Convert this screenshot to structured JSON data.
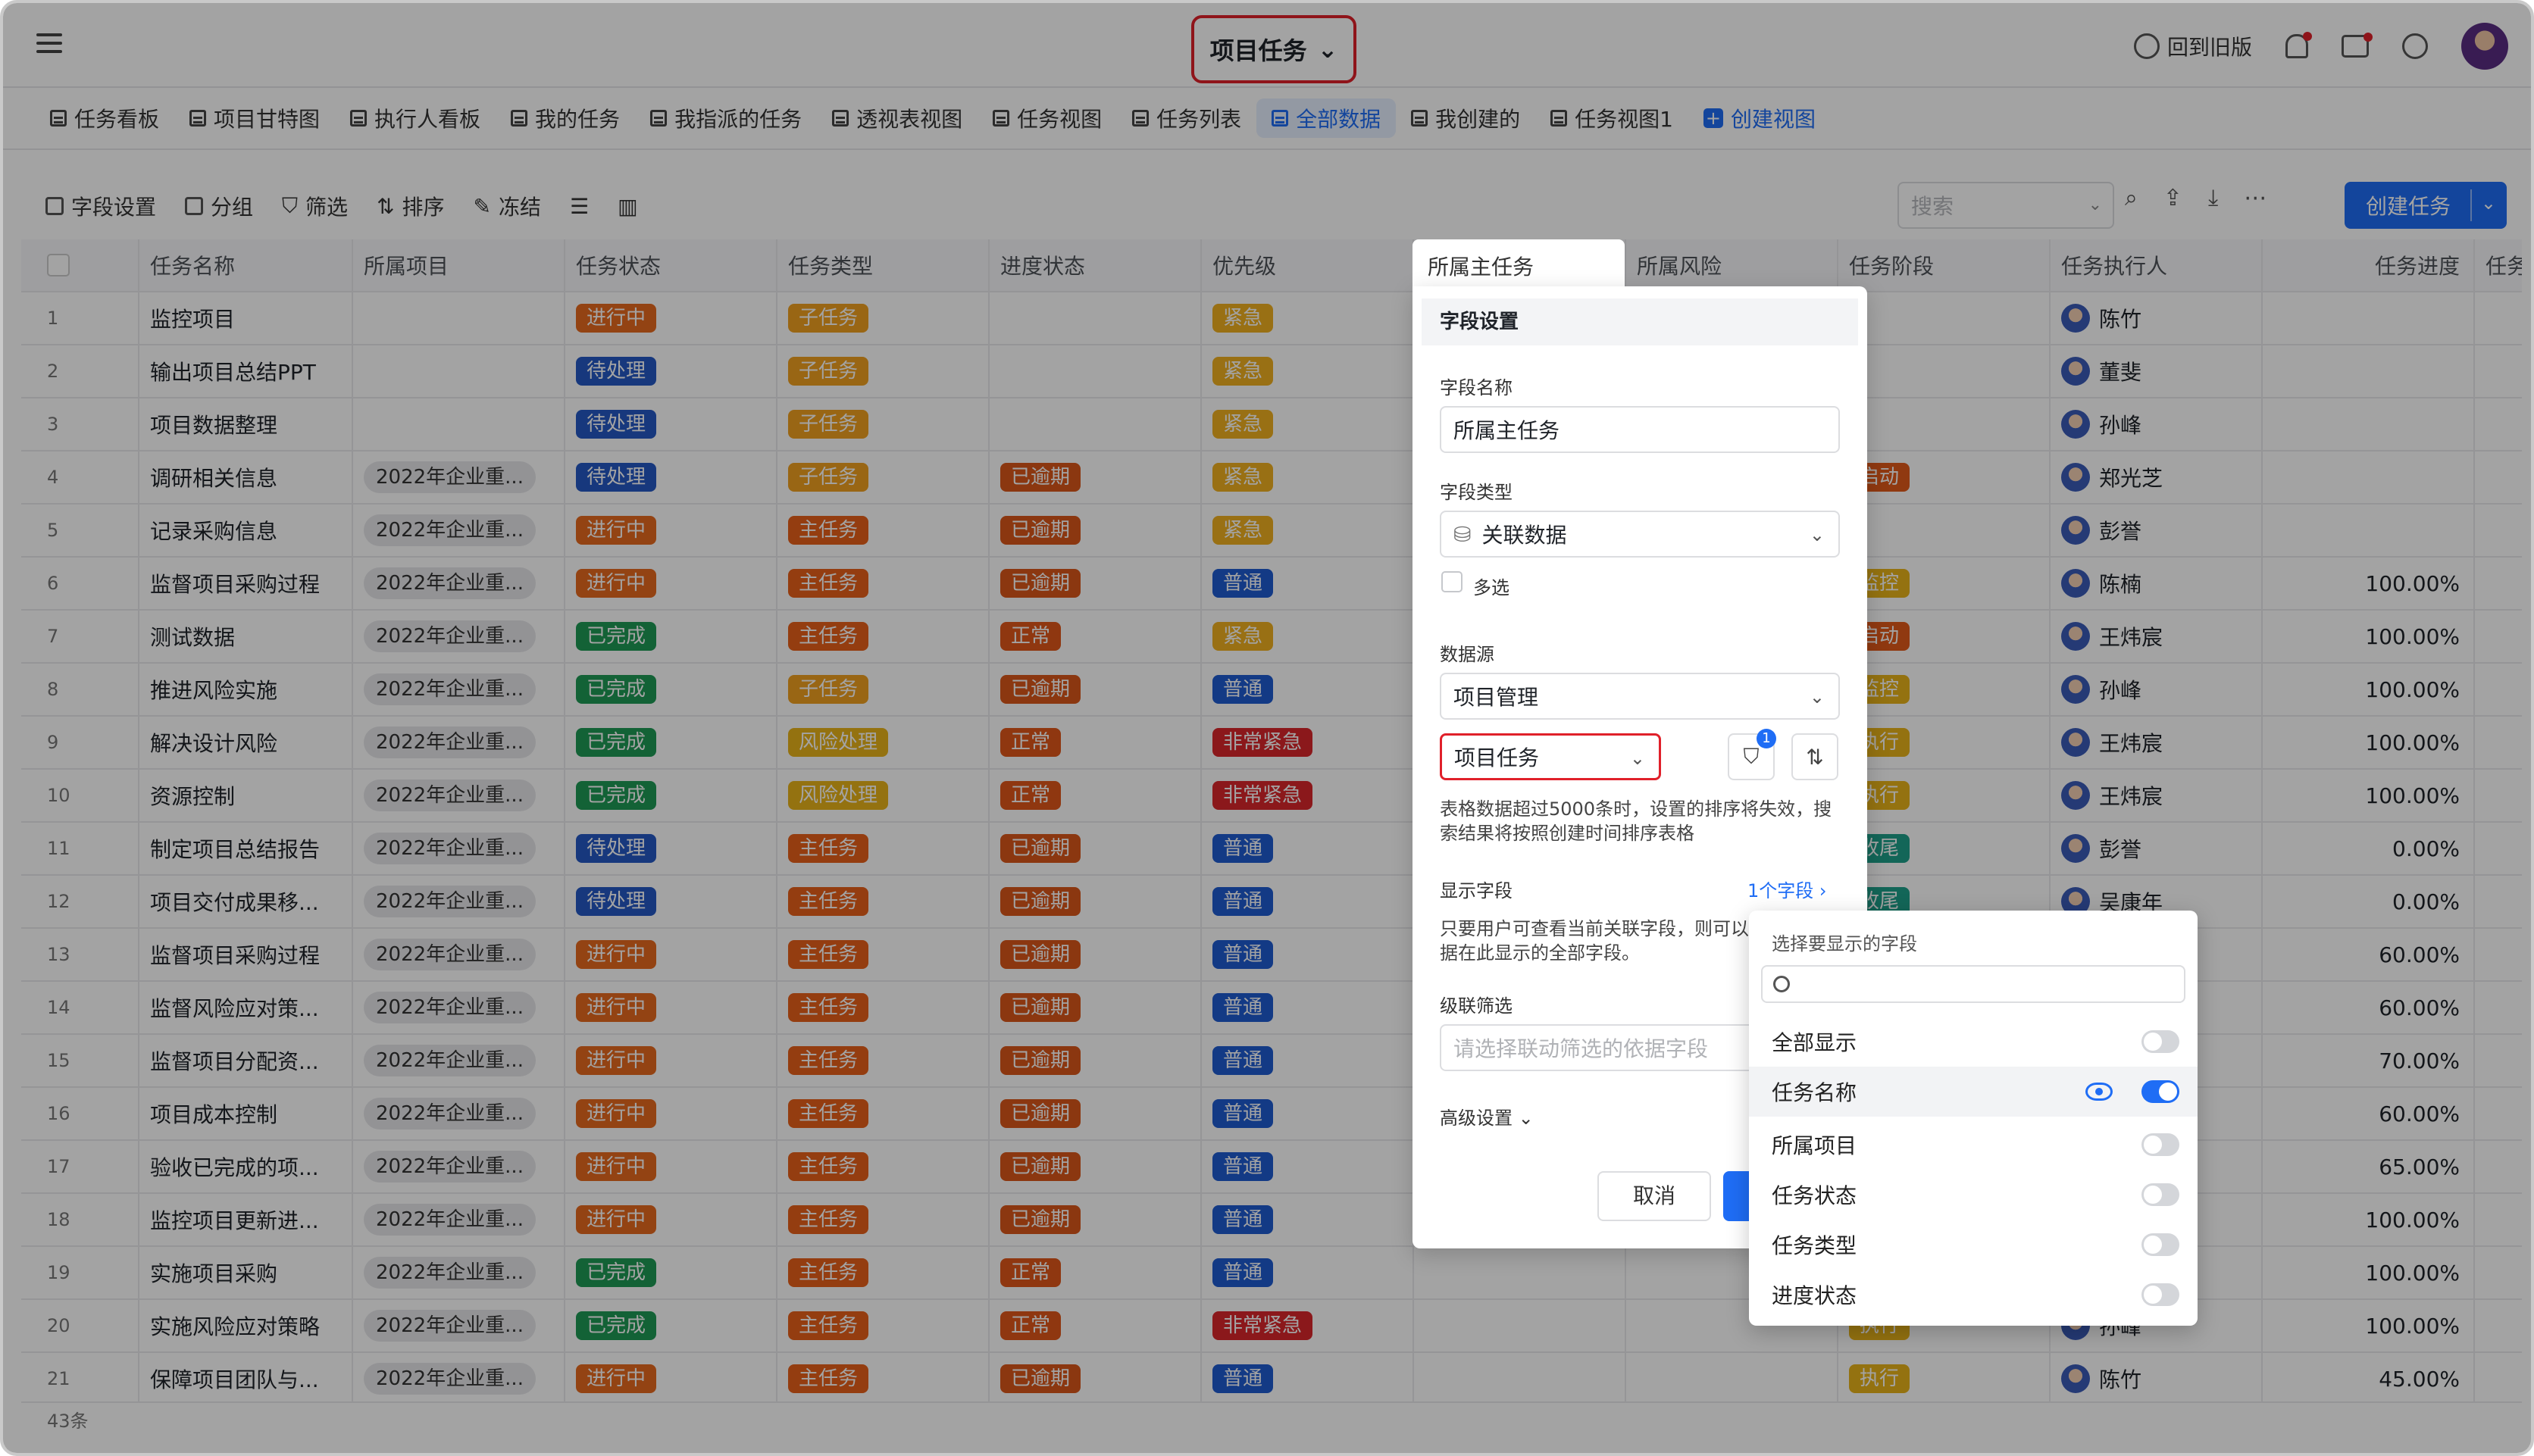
{
  "header": {
    "title": "项目任务",
    "back_label": "回到旧版"
  },
  "views": [
    {
      "label": "任务看板"
    },
    {
      "label": "项目甘特图"
    },
    {
      "label": "执行人看板"
    },
    {
      "label": "我的任务"
    },
    {
      "label": "我指派的任务"
    },
    {
      "label": "透视表视图"
    },
    {
      "label": "任务视图"
    },
    {
      "label": "任务列表"
    },
    {
      "label": "全部数据",
      "active": true
    },
    {
      "label": "我创建的"
    },
    {
      "label": "任务视图1"
    },
    {
      "label": "创建视图"
    }
  ],
  "toolbar": {
    "field_settings": "字段设置",
    "group": "分组",
    "filter": "筛选",
    "sort": "排序",
    "freeze": "冻结",
    "search_placeholder": "搜索",
    "create_task": "创建任务"
  },
  "columns": [
    "任务名称",
    "所属项目",
    "任务状态",
    "任务类型",
    "进度状态",
    "优先级",
    "所属主任务",
    "所属风险",
    "任务阶段",
    "任务执行人",
    "任务进度",
    "任务"
  ],
  "rows": [
    {
      "no": "1",
      "name": "监控项目",
      "project": "",
      "status": "进行中",
      "type": "子任务",
      "progress_state": "",
      "priority": "紧急",
      "stage": "",
      "assignee": "陈竹",
      "pct": ""
    },
    {
      "no": "2",
      "name": "输出项目总结PPT",
      "project": "",
      "status": "待处理",
      "type": "子任务",
      "progress_state": "",
      "priority": "紧急",
      "stage": "",
      "assignee": "董斐",
      "pct": ""
    },
    {
      "no": "3",
      "name": "项目数据整理",
      "project": "",
      "status": "待处理",
      "type": "子任务",
      "progress_state": "",
      "priority": "紧急",
      "stage": "",
      "assignee": "孙峰",
      "pct": ""
    },
    {
      "no": "4",
      "name": "调研相关信息",
      "project": "2022年企业重...",
      "status": "待处理",
      "type": "子任务",
      "progress_state": "已逾期",
      "priority": "紧急",
      "stage": "启动",
      "assignee": "郑光芝",
      "pct": ""
    },
    {
      "no": "5",
      "name": "记录采购信息",
      "project": "2022年企业重...",
      "status": "进行中",
      "type": "主任务",
      "progress_state": "已逾期",
      "priority": "紧急",
      "stage": "",
      "assignee": "彭誉",
      "pct": ""
    },
    {
      "no": "6",
      "name": "监督项目采购过程",
      "project": "2022年企业重...",
      "status": "进行中",
      "type": "主任务",
      "progress_state": "已逾期",
      "priority": "普通",
      "stage": "监控",
      "assignee": "陈楠",
      "pct": "100.00%"
    },
    {
      "no": "7",
      "name": "测试数据",
      "project": "2022年企业重...",
      "status": "已完成",
      "type": "主任务",
      "progress_state": "正常",
      "priority": "紧急",
      "stage": "启动",
      "assignee": "王炜宸",
      "pct": "100.00%"
    },
    {
      "no": "8",
      "name": "推进风险实施",
      "project": "2022年企业重...",
      "status": "已完成",
      "type": "子任务",
      "progress_state": "已逾期",
      "priority": "普通",
      "stage": "监控",
      "assignee": "孙峰",
      "pct": "100.00%"
    },
    {
      "no": "9",
      "name": "解决设计风险",
      "project": "2022年企业重...",
      "status": "已完成",
      "type": "风险处理",
      "progress_state": "正常",
      "priority": "非常紧急",
      "stage": "执行",
      "assignee": "王炜宸",
      "pct": "100.00%"
    },
    {
      "no": "10",
      "name": "资源控制",
      "project": "2022年企业重...",
      "status": "已完成",
      "type": "风险处理",
      "progress_state": "正常",
      "priority": "非常紧急",
      "stage": "执行",
      "assignee": "王炜宸",
      "pct": "100.00%"
    },
    {
      "no": "11",
      "name": "制定项目总结报告",
      "project": "2022年企业重...",
      "status": "待处理",
      "type": "主任务",
      "progress_state": "已逾期",
      "priority": "普通",
      "stage": "收尾",
      "assignee": "彭誉",
      "pct": "0.00%"
    },
    {
      "no": "12",
      "name": "项目交付成果移...",
      "project": "2022年企业重...",
      "status": "待处理",
      "type": "主任务",
      "progress_state": "已逾期",
      "priority": "普通",
      "stage": "收尾",
      "assignee": "吴康年",
      "pct": "0.00%"
    },
    {
      "no": "13",
      "name": "监督项目采购过程",
      "project": "2022年企业重...",
      "status": "进行中",
      "type": "主任务",
      "progress_state": "已逾期",
      "priority": "普通",
      "stage": "",
      "assignee": "",
      "pct": "60.00%"
    },
    {
      "no": "14",
      "name": "监督风险应对策...",
      "project": "2022年企业重...",
      "status": "进行中",
      "type": "主任务",
      "progress_state": "已逾期",
      "priority": "普通",
      "stage": "",
      "assignee": "",
      "pct": "60.00%"
    },
    {
      "no": "15",
      "name": "监督项目分配资...",
      "project": "2022年企业重...",
      "status": "进行中",
      "type": "主任务",
      "progress_state": "已逾期",
      "priority": "普通",
      "stage": "",
      "assignee": "",
      "pct": "70.00%"
    },
    {
      "no": "16",
      "name": "项目成本控制",
      "project": "2022年企业重...",
      "status": "进行中",
      "type": "主任务",
      "progress_state": "已逾期",
      "priority": "普通",
      "stage": "",
      "assignee": "",
      "pct": "60.00%"
    },
    {
      "no": "17",
      "name": "验收已完成的项...",
      "project": "2022年企业重...",
      "status": "进行中",
      "type": "主任务",
      "progress_state": "已逾期",
      "priority": "普通",
      "stage": "",
      "assignee": "",
      "pct": "65.00%"
    },
    {
      "no": "18",
      "name": "监控项目更新进...",
      "project": "2022年企业重...",
      "status": "进行中",
      "type": "主任务",
      "progress_state": "已逾期",
      "priority": "普通",
      "stage": "",
      "assignee": "",
      "pct": "100.00%"
    },
    {
      "no": "19",
      "name": "实施项目采购",
      "project": "2022年企业重...",
      "status": "已完成",
      "type": "主任务",
      "progress_state": "正常",
      "priority": "普通",
      "stage": "",
      "assignee": "",
      "pct": "100.00%"
    },
    {
      "no": "20",
      "name": "实施风险应对策略",
      "project": "2022年企业重...",
      "status": "已完成",
      "type": "主任务",
      "progress_state": "正常",
      "priority": "非常紧急",
      "stage": "执行",
      "assignee": "孙峰",
      "pct": "100.00%"
    },
    {
      "no": "21",
      "name": "保障项目团队与...",
      "project": "2022年企业重...",
      "status": "进行中",
      "type": "主任务",
      "progress_state": "已逾期",
      "priority": "普通",
      "stage": "执行",
      "assignee": "陈竹",
      "pct": "45.00%"
    }
  ],
  "footer": {
    "count": "43条"
  },
  "colors": {
    "进行中": "#e66a1f",
    "待处理": "#2458c4",
    "已完成": "#1f9a55",
    "子任务": "#f0a020",
    "主任务": "#e86019",
    "风险处理": "#e8b21a",
    "已逾期": "#d9561a",
    "正常": "#e0571a",
    "紧急": "#f0b020",
    "普通": "#1f5bd0",
    "非常紧急": "#d9262b",
    "启动": "#e25a1a",
    "监控": "#e8b21a",
    "执行": "#e8b21a",
    "收尾": "#1fa08a",
    "accent": "#1f6df5"
  },
  "field_panel": {
    "column_name": "所属主任务",
    "heading": "字段设置",
    "name_label": "字段名称",
    "name_value": "所属主任务",
    "type_label": "字段类型",
    "type_value": "关联数据",
    "multi_label": "多选",
    "source_label": "数据源",
    "source_app": "项目管理",
    "source_table": "项目任务",
    "filter_badge": "1",
    "note": "表格数据超过5000条时，设置的排序将失效，搜索结果将按照创建时间排序表格",
    "display_label": "显示字段",
    "display_link": "1个字段",
    "display_note": "只要用户可查看当前关联字段，则可以据在此显示的全部字段。",
    "cascade_label": "级联筛选",
    "cascade_placeholder": "请选择联动筛选的依据字段",
    "advanced_label": "高级设置",
    "cancel": "取消"
  },
  "field_popup": {
    "title": "选择要显示的字段",
    "items": [
      {
        "label": "全部显示",
        "on": false
      },
      {
        "label": "任务名称",
        "on": true
      },
      {
        "label": "所属项目",
        "on": false
      },
      {
        "label": "任务状态",
        "on": false
      },
      {
        "label": "任务类型",
        "on": false
      },
      {
        "label": "进度状态",
        "on": false
      }
    ]
  }
}
